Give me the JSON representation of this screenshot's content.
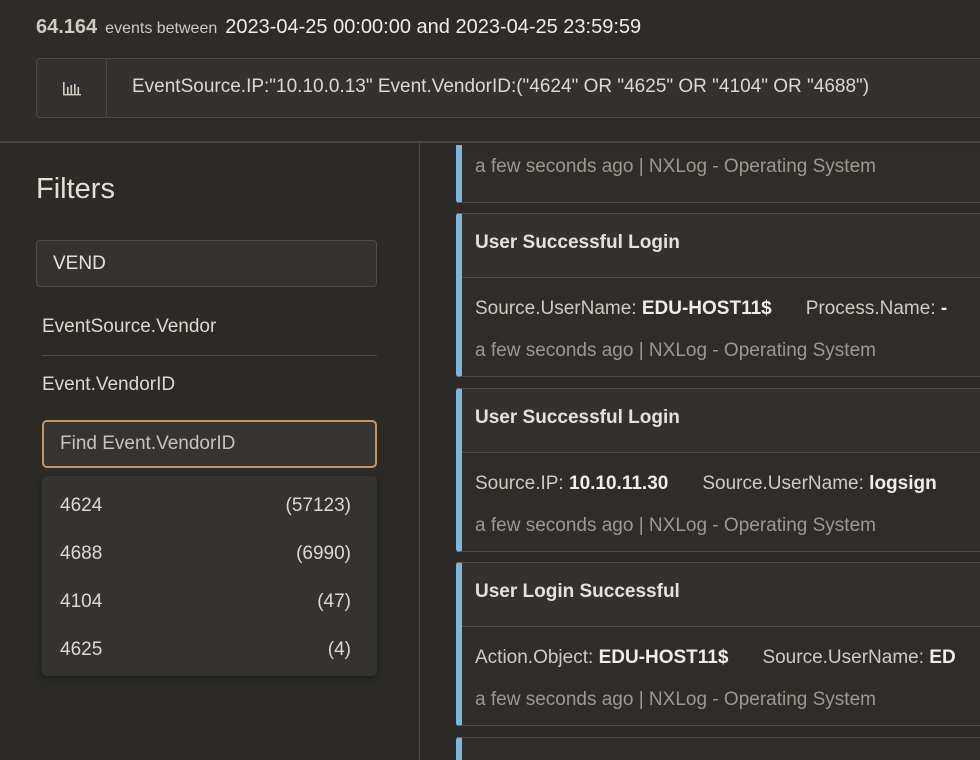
{
  "header": {
    "count": "64.164",
    "between_label": "events between",
    "range": "2023-04-25 00:00:00 and 2023-04-25 23:59:59",
    "query": "EventSource.IP:\"10.10.0.13\" Event.VendorID:(\"4624\" OR \"4625\" OR \"4104\" OR \"4688\")"
  },
  "filters": {
    "title": "Filters",
    "search_value": "VEND",
    "fields": [
      "EventSource.Vendor",
      "Event.VendorID"
    ],
    "find_placeholder": "Find Event.VendorID",
    "values": [
      {
        "value": "4624",
        "count": "(57123)"
      },
      {
        "value": "4688",
        "count": "(6990)"
      },
      {
        "value": "4104",
        "count": "(47)"
      },
      {
        "value": "4625",
        "count": "(4)"
      }
    ]
  },
  "events": [
    {
      "meta": "a few seconds ago | NXLog - Operating System"
    },
    {
      "title": "User Successful Login",
      "fields": [
        {
          "key": "Source.UserName: ",
          "value": "EDU-HOST11$"
        },
        {
          "key": "Process.Name: ",
          "value": "-"
        }
      ],
      "meta": "a few seconds ago | NXLog - Operating System"
    },
    {
      "title": "User Successful Login",
      "fields": [
        {
          "key": "Source.IP: ",
          "value": "10.10.11.30"
        },
        {
          "key": "Source.UserName: ",
          "value": "logsign"
        }
      ],
      "meta": "a few seconds ago | NXLog - Operating System"
    },
    {
      "title": "User Login Successful",
      "fields": [
        {
          "key": "Action.Object: ",
          "value": "EDU-HOST11$"
        },
        {
          "key": "Source.UserName: ",
          "value": "ED"
        }
      ],
      "meta": "a few seconds ago | NXLog - Operating System"
    }
  ],
  "icons": {
    "chart_button": "bar-chart-icon"
  },
  "colors": {
    "accent_border": "#7fb7d8",
    "focus_border": "#c59466"
  }
}
